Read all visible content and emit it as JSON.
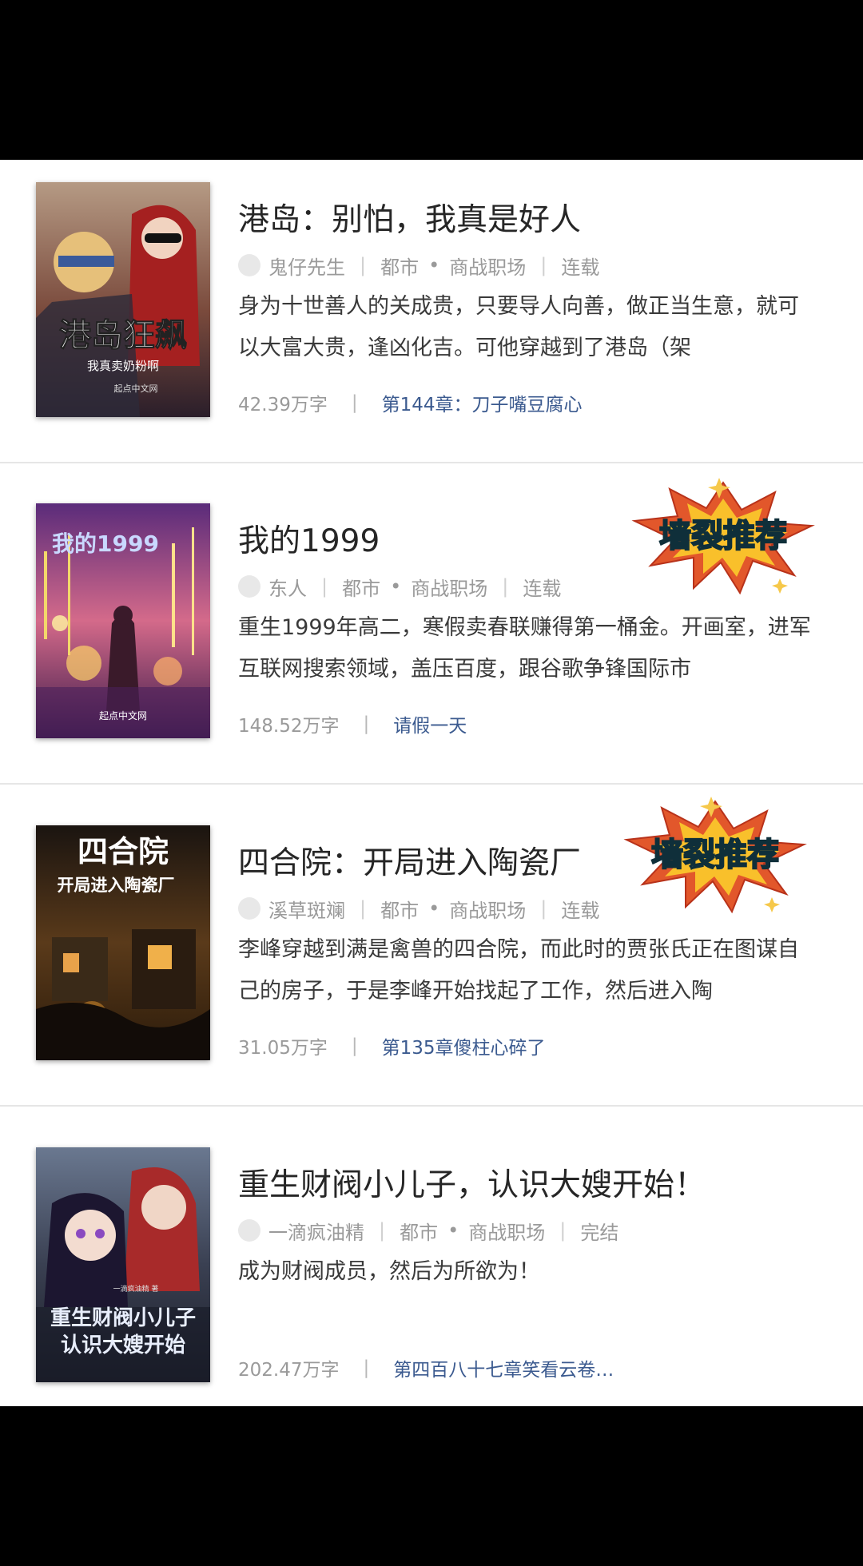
{
  "books": [
    {
      "title": "港岛：别怕，我真是好人",
      "author": "鬼仔先生",
      "category": "都市",
      "subcategory": "商战职场",
      "status": "连载",
      "description": "身为十世善人的关成贵，只要导人向善，做正当生意，就可以大富大贵，逢凶化吉。可他穿越到了港岛（架",
      "word_count": "42.39万字",
      "latest_chapter": "第144章：刀子嘴豆腐心",
      "cover_title": "港岛狂飙",
      "cover_subtitle": "我真卖奶粉啊",
      "cover_publisher": "起点中文网",
      "badge": ""
    },
    {
      "title": "我的1999",
      "author": "东人",
      "category": "都市",
      "subcategory": "商战职场",
      "status": "连载",
      "description": "重生1999年高二，寒假卖春联赚得第一桶金。开画室，进军互联网搜索领域，盖压百度，跟谷歌争锋国际市",
      "word_count": "148.52万字",
      "latest_chapter": "请假一天",
      "cover_title": "我的1999",
      "cover_subtitle": "",
      "cover_publisher": "起点中文网",
      "badge": "墙裂推荐"
    },
    {
      "title": "四合院：开局进入陶瓷厂",
      "author": "溪草斑斓",
      "category": "都市",
      "subcategory": "商战职场",
      "status": "连载",
      "description": "李峰穿越到满是禽兽的四合院，而此时的贾张氏正在图谋自己的房子，于是李峰开始找起了工作，然后进入陶",
      "word_count": "31.05万字",
      "latest_chapter": "第135章傻柱心碎了",
      "cover_title": "四合院",
      "cover_subtitle": "开局进入陶瓷厂",
      "cover_publisher": "",
      "badge": "墙裂推荐"
    },
    {
      "title": "重生财阀小儿子，认识大嫂开始！",
      "author": "一滴疯油精",
      "category": "都市",
      "subcategory": "商战职场",
      "status": "完结",
      "description": "成为财阀成员，然后为所欲为！",
      "word_count": "202.47万字",
      "latest_chapter": "第四百八十七章笑看云卷…",
      "cover_title": "重生财阀小儿子",
      "cover_subtitle": "认识大嫂开始",
      "cover_publisher": "一滴疯油精 著",
      "badge": ""
    }
  ],
  "colors": {
    "title": "#262626",
    "meta": "#9a9a9a",
    "chapter_link": "#3b5a8f",
    "badge_text": "#2b6f86",
    "badge_burst": "#e2572b"
  }
}
